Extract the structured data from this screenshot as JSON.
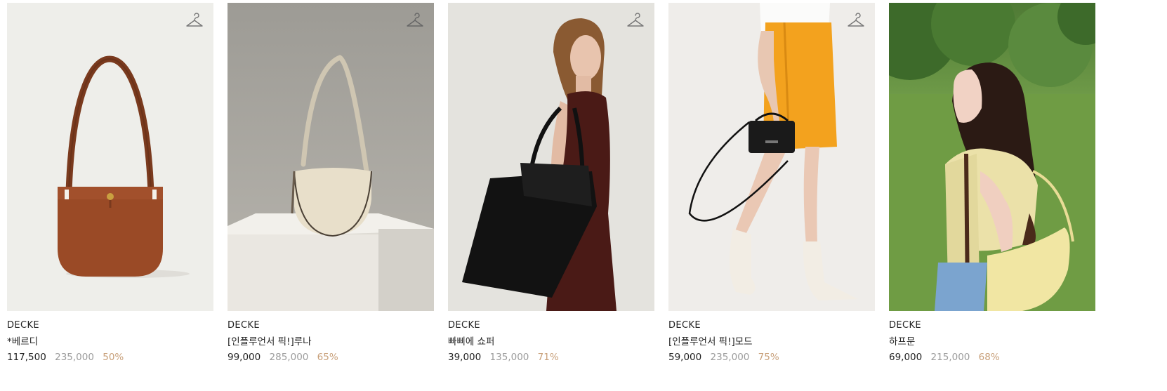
{
  "colors": {
    "text": "#222222",
    "original_price": "#9c9c9c",
    "discount": "#c8a07a",
    "icon_stroke": "#777777"
  },
  "products": [
    {
      "brand": "DECKE",
      "name": "*베르디",
      "sale_price": "117,500",
      "original_price": "235,000",
      "discount": "50%",
      "image": "brown-leather-shoulder-bag",
      "wishlist_icon": "hanger-icon"
    },
    {
      "brand": "DECKE",
      "name": "[인플루언서 픽!]루나",
      "sale_price": "99,000",
      "original_price": "285,000",
      "discount": "65%",
      "image": "cream-half-moon-bag-on-pedestal",
      "wishlist_icon": "hanger-icon"
    },
    {
      "brand": "DECKE",
      "name": "빠삐에 쇼퍼",
      "sale_price": "39,000",
      "original_price": "135,000",
      "discount": "71%",
      "image": "model-with-black-shopper-bag",
      "wishlist_icon": "hanger-icon"
    },
    {
      "brand": "DECKE",
      "name": "[인플루언서 픽!]모드",
      "sale_price": "59,000",
      "original_price": "235,000",
      "discount": "75%",
      "image": "model-with-black-mini-bag",
      "wishlist_icon": "hanger-icon"
    },
    {
      "brand": "DECKE",
      "name": "하프문",
      "sale_price": "69,000",
      "original_price": "215,000",
      "discount": "68%",
      "image": "model-with-yellow-half-moon-bag-outdoors",
      "wishlist_icon": null
    }
  ]
}
